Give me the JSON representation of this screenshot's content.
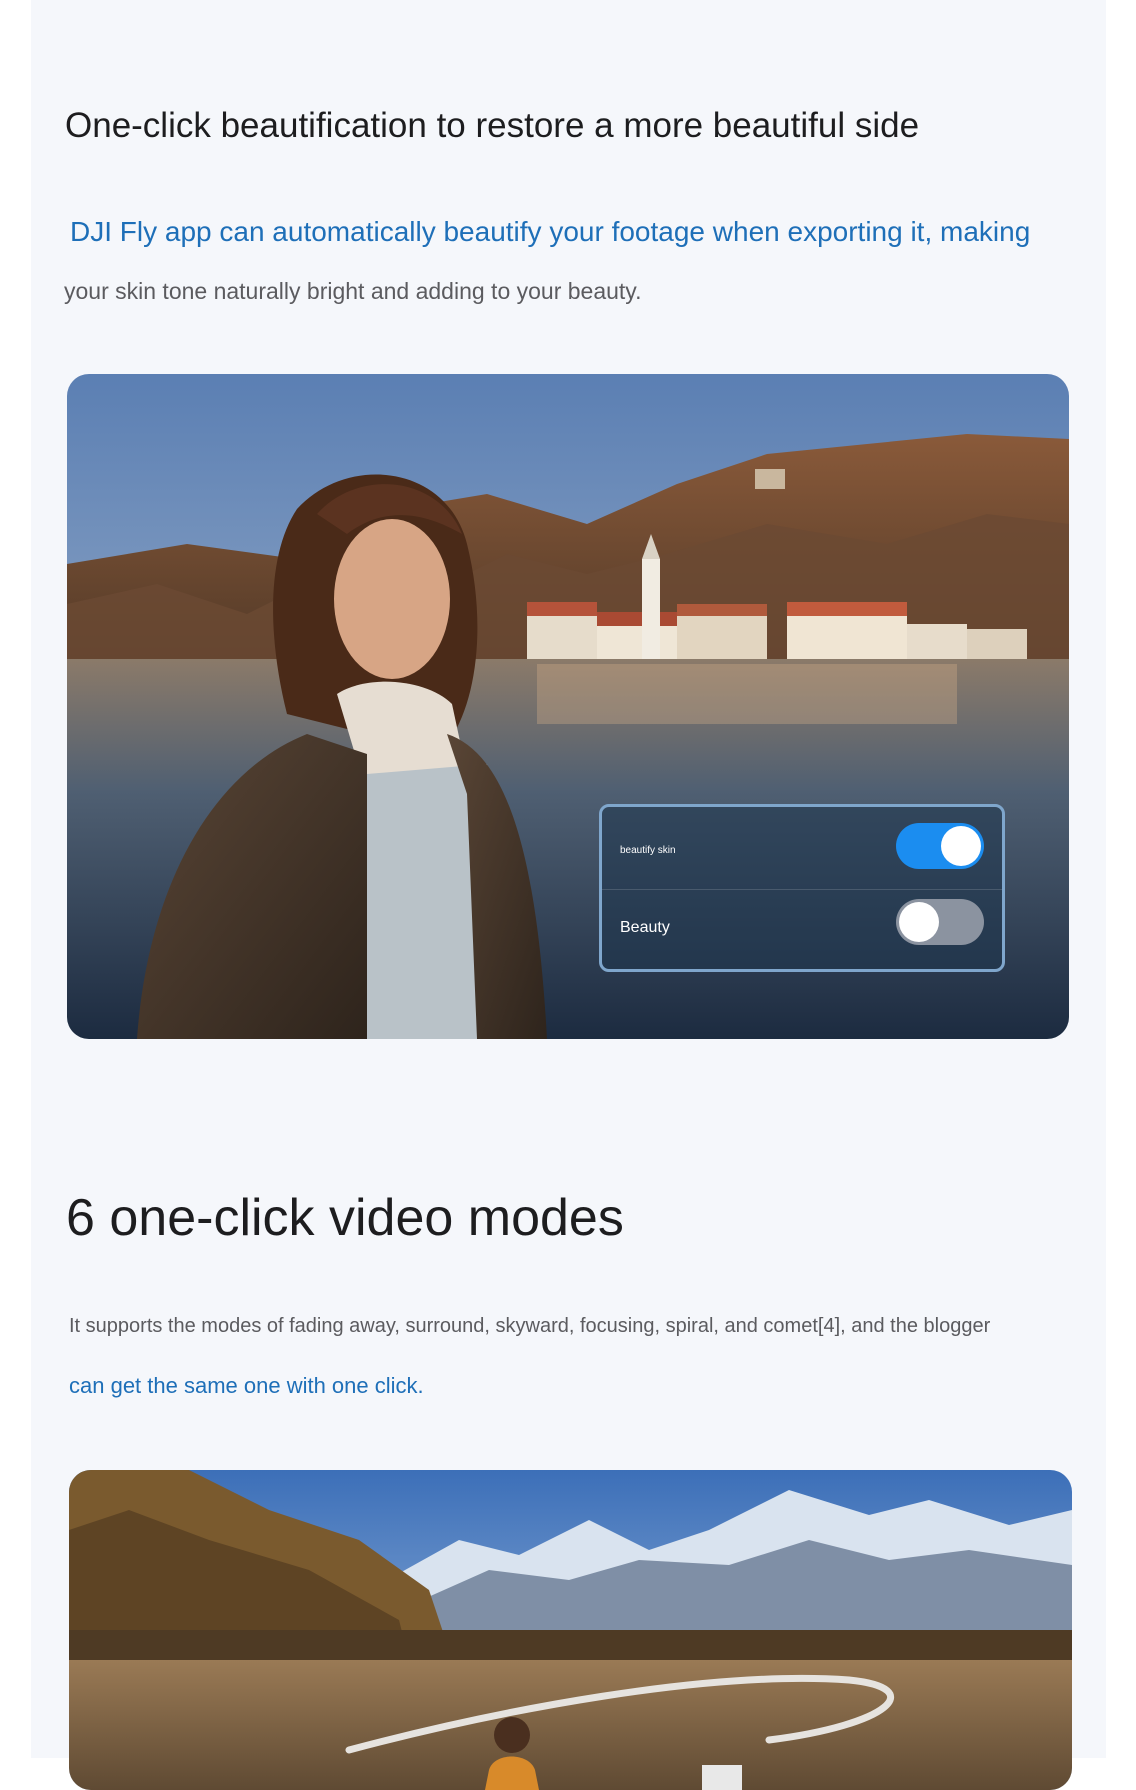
{
  "section1": {
    "title": "One-click beautification to restore a more beautiful side",
    "desc_line1": "DJI Fly app can automatically beautify your footage when exporting it, making",
    "desc_line2": "your skin tone naturally bright and adding to your beauty.",
    "settings": [
      {
        "label": "beautify skin",
        "state": "on"
      },
      {
        "label": "Beauty",
        "state": "off"
      }
    ]
  },
  "section2": {
    "title": "6 one-click video modes",
    "desc_line1": "It supports the modes of fading away, surround, skyward, focusing, spiral, and comet[4], and the blogger",
    "desc_line2": "can get the same one with one click."
  },
  "colors": {
    "accent_text": "#1e6fb8",
    "toggle_on": "#1b8df0",
    "panel_bg": "#f5f7fb"
  }
}
